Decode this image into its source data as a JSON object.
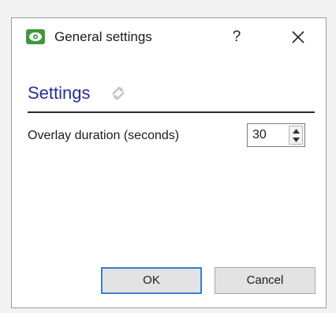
{
  "dialog": {
    "title": "General settings",
    "help_label": "?",
    "app_icon": "eye-icon",
    "close_icon": "close-icon"
  },
  "section": {
    "heading": "Settings",
    "icon": "refresh-arrows-icon"
  },
  "overlay_duration": {
    "label": "Overlay duration (seconds)",
    "value": "30"
  },
  "buttons": {
    "ok": "OK",
    "cancel": "Cancel"
  },
  "colors": {
    "heading": "#2a2f8f",
    "app_icon_bg": "#3c9a3c",
    "default_button_border": "#3b7fd0"
  }
}
